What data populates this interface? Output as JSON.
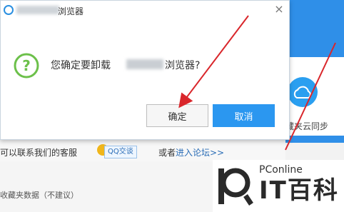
{
  "dialog": {
    "title": "浏览器",
    "close_glyph": "×",
    "message_prefix": "您确定要卸载",
    "message_suffix": "浏览器?",
    "confirm_label": "确定",
    "cancel_label": "取消"
  },
  "background": {
    "sync_label": "藏夹云同步",
    "contact_text": "可以联系我们的客服",
    "qq_label": "QQ交谈",
    "or_text": "或者",
    "forum_link": "进入论坛>>",
    "favorites_text": "收藏夹数据（不建议）"
  },
  "watermark": {
    "pconline": "PConline",
    "brand": "IT百科"
  },
  "colors": {
    "accent": "#2b97f0",
    "arrow": "#d9262b",
    "question_icon": "#6cc04a"
  },
  "icons": {
    "ie": "ie-icon",
    "question": "question-icon",
    "close": "close-icon",
    "cloud_sync": "cloud-sync-icon",
    "qq": "qq-icon"
  }
}
